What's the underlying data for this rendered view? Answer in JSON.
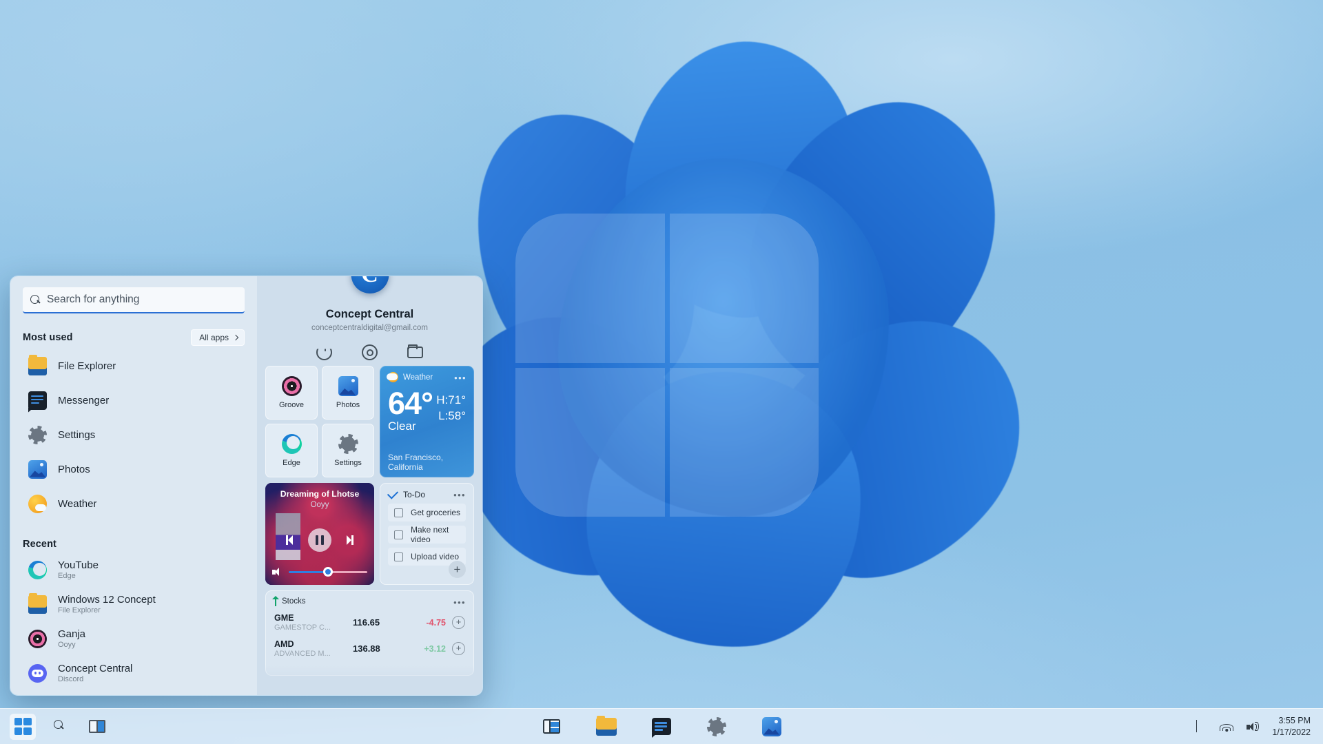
{
  "desktop": {
    "wallpaper_name": "windows-bloom-wallpaper",
    "accent_color": "#2a6fd4"
  },
  "start_menu": {
    "search": {
      "placeholder": "Search for anything",
      "value": "",
      "icon": "search-icon"
    },
    "most_used": {
      "title": "Most used",
      "all_apps_label": "All apps",
      "items": [
        {
          "label": "File Explorer",
          "icon": "folder-icon"
        },
        {
          "label": "Messenger",
          "icon": "messenger-icon"
        },
        {
          "label": "Settings",
          "icon": "gear-icon"
        },
        {
          "label": "Photos",
          "icon": "photos-icon"
        },
        {
          "label": "Weather",
          "icon": "weather-icon"
        }
      ]
    },
    "recent": {
      "title": "Recent",
      "items": [
        {
          "label": "YouTube",
          "sub": "Edge",
          "icon": "edge-icon"
        },
        {
          "label": "Windows 12 Concept",
          "sub": "File Explorer",
          "icon": "folder-icon"
        },
        {
          "label": "Ganja",
          "sub": "Ooyy",
          "icon": "groove-icon"
        },
        {
          "label": "Concept Central",
          "sub": "Discord",
          "icon": "discord-icon"
        }
      ]
    },
    "profile": {
      "name": "Concept Central",
      "email": "conceptcentraldigital@gmail.com",
      "avatar_letter": "C",
      "actions": [
        {
          "name": "power-icon"
        },
        {
          "name": "settings-gear-icon"
        },
        {
          "name": "folder-icon"
        }
      ]
    },
    "tiles": [
      {
        "label": "Groove",
        "icon": "groove-icon"
      },
      {
        "label": "Photos",
        "icon": "photos-icon"
      },
      {
        "label": "Edge",
        "icon": "edge-icon"
      },
      {
        "label": "Settings",
        "icon": "gear-icon"
      }
    ],
    "weather_widget": {
      "title": "Weather",
      "temperature": "64°",
      "condition": "Clear",
      "high": "H:71°",
      "low": "L:58°",
      "location": "San Francisco, California",
      "menu": "•••"
    },
    "music_widget": {
      "track": "Dreaming of Lhotse",
      "artist": "Ooyy",
      "volume_percent": 50,
      "controls": [
        "previous",
        "pause",
        "next"
      ]
    },
    "todo_widget": {
      "title": "To-Do",
      "menu": "•••",
      "add_label": "+",
      "items": [
        {
          "label": "Get groceries",
          "checked": false
        },
        {
          "label": "Make next video",
          "checked": false
        },
        {
          "label": "Upload video",
          "checked": false
        }
      ]
    },
    "stocks_widget": {
      "title": "Stocks",
      "menu": "•••",
      "rows": [
        {
          "symbol": "GME",
          "company": "GAMESTOP C...",
          "price": "116.65",
          "change": "-4.75",
          "direction": "down",
          "add": "+"
        },
        {
          "symbol": "AMD",
          "company": "ADVANCED M...",
          "price": "136.88",
          "change": "+3.12",
          "direction": "up",
          "add": "+"
        }
      ],
      "down_color": "#e0556e",
      "up_color": "#7fc9a4"
    }
  },
  "taskbar": {
    "left": [
      {
        "name": "start-button",
        "icon": "windows-logo-icon",
        "active": true
      },
      {
        "name": "search-button",
        "icon": "search-icon"
      },
      {
        "name": "task-view-button",
        "icon": "task-view-icon"
      }
    ],
    "center": [
      {
        "name": "widgets-button",
        "icon": "widgets-icon"
      },
      {
        "name": "file-explorer-button",
        "icon": "folder-icon"
      },
      {
        "name": "messenger-button",
        "icon": "messenger-icon"
      },
      {
        "name": "settings-button",
        "icon": "gear-icon"
      },
      {
        "name": "photos-button",
        "icon": "photos-icon"
      }
    ],
    "tray": {
      "overflow": "chevron-up-icon",
      "network": "wifi-icon",
      "volume": "speaker-icon",
      "time": "3:55 PM",
      "date": "1/17/2022"
    }
  }
}
